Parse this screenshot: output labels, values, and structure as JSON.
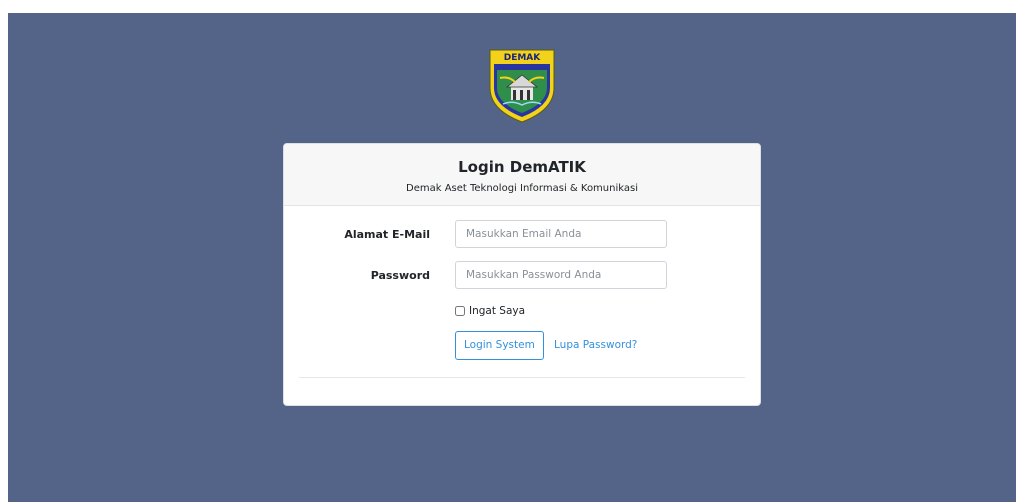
{
  "logo": {
    "text": "DEMAK",
    "alt": "Lambang Kabupaten Demak"
  },
  "login": {
    "title": "Login DemATIK",
    "subtitle": "Demak Aset Teknologi Informasi & Komunikasi",
    "email_label": "Alamat E-Mail",
    "email_placeholder": "Masukkan Email Anda",
    "email_value": "",
    "password_label": "Password",
    "password_placeholder": "Masukkan Password Anda",
    "password_value": "",
    "remember_label": "Ingat Saya",
    "remember_checked": false,
    "submit_label": "Login System",
    "forgot_label": "Lupa Password?"
  },
  "colors": {
    "background": "#536488",
    "accent": "#3490dc"
  }
}
